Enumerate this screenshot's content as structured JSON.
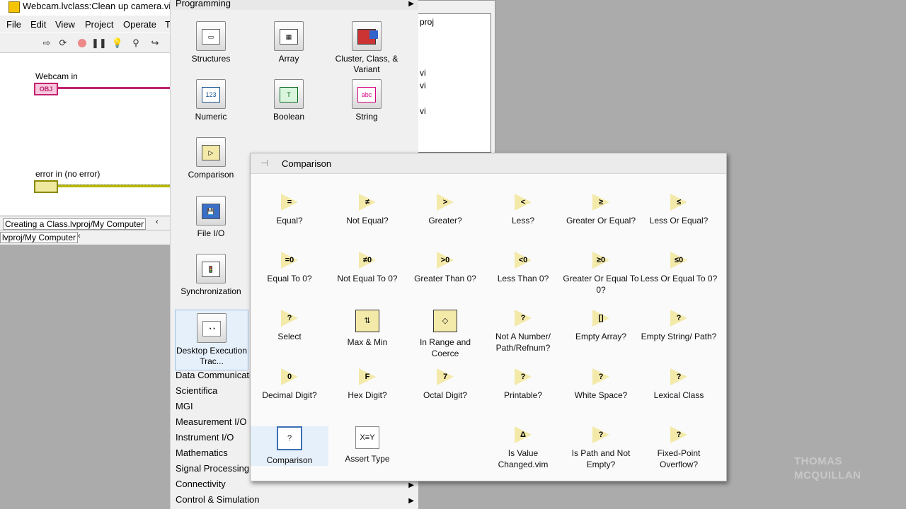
{
  "bd_window": {
    "title": "Webcam.lvclass:Clean up camera.vi Bl",
    "menu": [
      "File",
      "Edit",
      "View",
      "Project",
      "Operate",
      "T"
    ],
    "wire_labels": [
      "Webcam in",
      "error in (no error)"
    ],
    "terminals": [
      "OBJ",
      ""
    ],
    "status_project": "Creating a Class.lvproj/My Computer",
    "status_project2": "lvproj/My Computer"
  },
  "project_window": {
    "items": [
      "proj",
      "vi",
      "vi",
      "vi"
    ]
  },
  "programming_palette": {
    "header": "Programming",
    "items": [
      {
        "label": "Structures",
        "icon": "structures-icon"
      },
      {
        "label": "Array",
        "icon": "array-icon"
      },
      {
        "label": "Cluster, Class, & Variant",
        "icon": "cluster-icon"
      },
      {
        "label": "Numeric",
        "icon": "numeric-icon"
      },
      {
        "label": "Boolean",
        "icon": "boolean-icon"
      },
      {
        "label": "String",
        "icon": "string-icon"
      },
      {
        "label": "Comparison",
        "icon": "comparison-icon"
      },
      {
        "label": "File I/O",
        "icon": "file-io-icon"
      },
      {
        "label": "Synchronization",
        "icon": "synchronization-icon"
      },
      {
        "label": "Desktop Execution Trac...",
        "icon": "desktop-execution-icon"
      }
    ],
    "categories": [
      {
        "label": "Data Communicati",
        "arrow": false
      },
      {
        "label": "Scientifica",
        "arrow": false
      },
      {
        "label": "MGI",
        "arrow": false
      },
      {
        "label": "Measurement I/O",
        "arrow": false
      },
      {
        "label": "Instrument I/O",
        "arrow": false
      },
      {
        "label": "Mathematics",
        "arrow": false
      },
      {
        "label": "Signal Processing",
        "arrow": false
      },
      {
        "label": "Connectivity",
        "arrow": true
      },
      {
        "label": "Control & Simulation",
        "arrow": true
      }
    ]
  },
  "comparison_palette": {
    "header": "Comparison",
    "items": [
      {
        "label": "Equal?",
        "glyph": "="
      },
      {
        "label": "Not Equal?",
        "glyph": "≠"
      },
      {
        "label": "Greater?",
        "glyph": ">"
      },
      {
        "label": "Less?",
        "glyph": "<"
      },
      {
        "label": "Greater Or Equal?",
        "glyph": "≥"
      },
      {
        "label": "Less Or Equal?",
        "glyph": "≤"
      },
      {
        "label": "Equal To 0?",
        "glyph": "=0"
      },
      {
        "label": "Not Equal To 0?",
        "glyph": "≠0"
      },
      {
        "label": "Greater Than 0?",
        "glyph": ">0"
      },
      {
        "label": "Less Than 0?",
        "glyph": "<0"
      },
      {
        "label": "Greater Or Equal To 0?",
        "glyph": "≥0"
      },
      {
        "label": "Less Or Equal To 0?",
        "glyph": "≤0"
      },
      {
        "label": "Select",
        "glyph": "?"
      },
      {
        "label": "Max & Min",
        "glyph": "⇅"
      },
      {
        "label": "In Range and Coerce",
        "glyph": "◇"
      },
      {
        "label": "Not A Number/ Path/Refnum?",
        "glyph": "?"
      },
      {
        "label": "Empty Array?",
        "glyph": "[]"
      },
      {
        "label": "Empty String/ Path?",
        "glyph": "?"
      },
      {
        "label": "Decimal Digit?",
        "glyph": "0"
      },
      {
        "label": "Hex Digit?",
        "glyph": "F"
      },
      {
        "label": "Octal Digit?",
        "glyph": "7"
      },
      {
        "label": "Printable?",
        "glyph": "?"
      },
      {
        "label": "White Space?",
        "glyph": "?"
      },
      {
        "label": "Lexical Class",
        "glyph": "?"
      },
      {
        "label": "Comparison",
        "glyph": "?"
      },
      {
        "label": "Assert Type",
        "glyph": "X≡Y"
      },
      {
        "label": "Is Value Changed.vim",
        "glyph": "Δ"
      },
      {
        "label": "Is Path and Not Empty?",
        "glyph": "?"
      },
      {
        "label": "Fixed-Point Overflow?",
        "glyph": "?"
      }
    ]
  },
  "watermark": {
    "line1": "THOMAS",
    "line2": "MCQUILLAN"
  }
}
